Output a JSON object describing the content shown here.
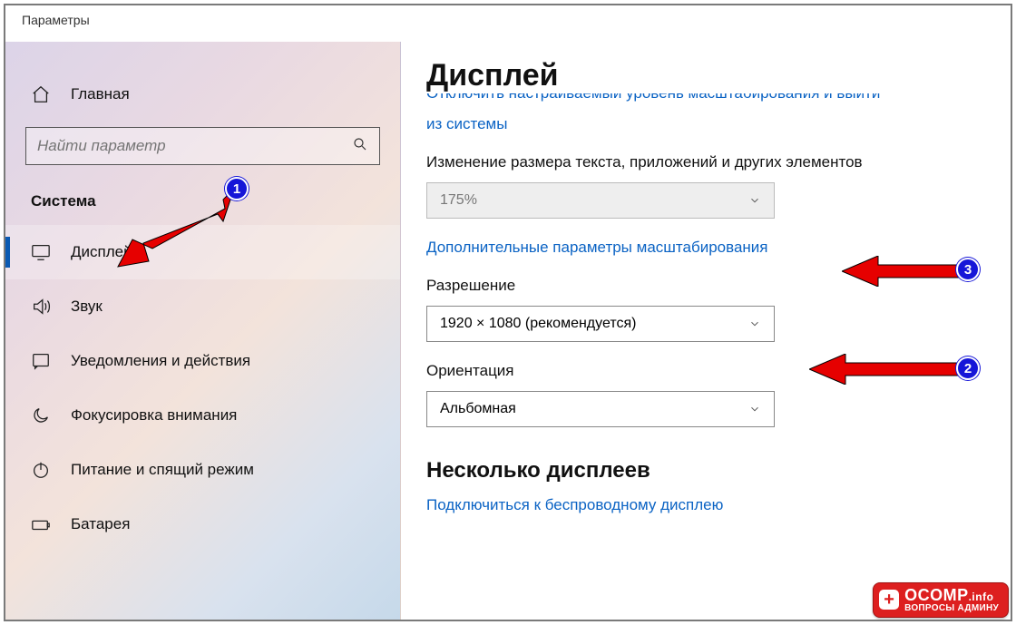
{
  "window": {
    "title": "Параметры"
  },
  "sidebar": {
    "home_label": "Главная",
    "search_placeholder": "Найти параметр",
    "section_label": "Система",
    "items": [
      {
        "label": "Дисплей",
        "icon": "monitor",
        "selected": true
      },
      {
        "label": "Звук",
        "icon": "sound",
        "selected": false
      },
      {
        "label": "Уведомления и действия",
        "icon": "notifications",
        "selected": false
      },
      {
        "label": "Фокусировка внимания",
        "icon": "focus",
        "selected": false
      },
      {
        "label": "Питание и спящий режим",
        "icon": "power",
        "selected": false
      },
      {
        "label": "Батарея",
        "icon": "battery",
        "selected": false
      }
    ]
  },
  "content": {
    "page_title": "Дисплей",
    "clipped_link_top": "Отключить настраиваемый уровень масштабирования и выйти",
    "clipped_link_bottom": "из системы",
    "scale_label": "Изменение размера текста, приложений и других элементов",
    "scale_value": "175%",
    "advanced_scale_link": "Дополнительные параметры масштабирования",
    "resolution_label": "Разрешение",
    "resolution_value": "1920 × 1080 (рекомендуется)",
    "orientation_label": "Ориентация",
    "orientation_value": "Альбомная",
    "multi_header": "Несколько дисплеев",
    "wireless_link": "Подключиться к беспроводному дисплею"
  },
  "annotations": {
    "badge1": "1",
    "badge2": "2",
    "badge3": "3"
  },
  "watermark": {
    "line1_main": "OCOMP",
    "line1_suffix": ".info",
    "line2": "ВОПРОСЫ АДМИНУ"
  }
}
